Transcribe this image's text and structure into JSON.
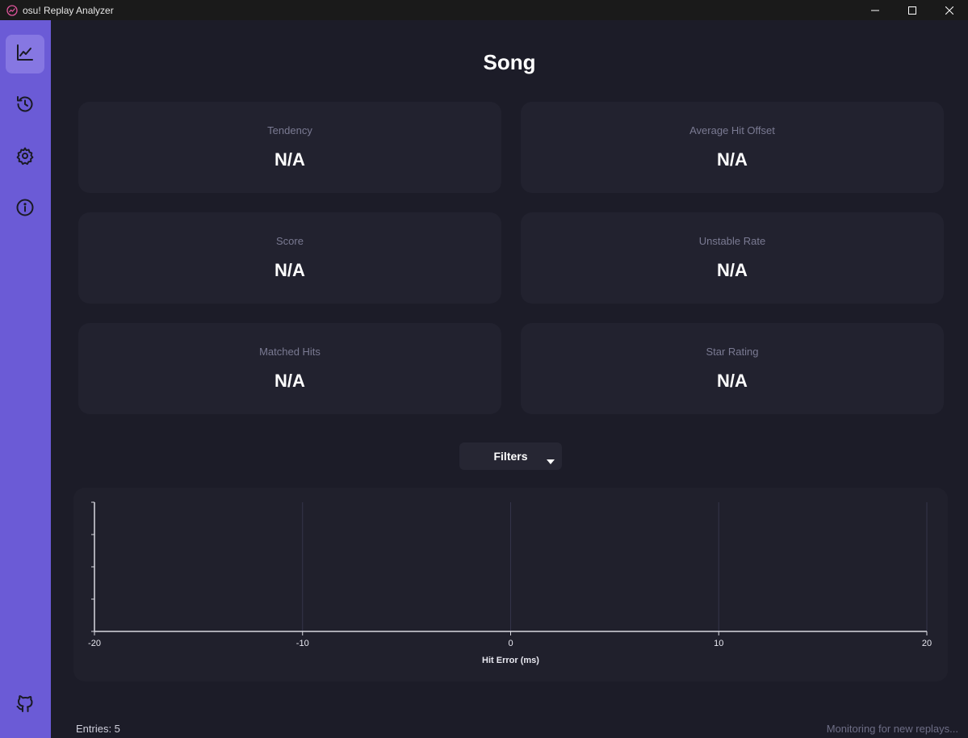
{
  "window": {
    "title": "osu! Replay Analyzer",
    "controls": [
      "minimize",
      "maximize",
      "close"
    ]
  },
  "sidebar": {
    "items": [
      {
        "name": "chart-icon",
        "active": true
      },
      {
        "name": "history-icon",
        "active": false
      },
      {
        "name": "settings-icon",
        "active": false
      },
      {
        "name": "info-icon",
        "active": false
      }
    ],
    "footer_icon": "github-icon"
  },
  "main": {
    "title": "Song",
    "stats": [
      {
        "label": "Tendency",
        "value": "N/A"
      },
      {
        "label": "Average Hit Offset",
        "value": "N/A"
      },
      {
        "label": "Score",
        "value": "N/A"
      },
      {
        "label": "Unstable Rate",
        "value": "N/A"
      },
      {
        "label": "Matched Hits",
        "value": "N/A"
      },
      {
        "label": "Star Rating",
        "value": "N/A"
      }
    ],
    "filters_label": "Filters"
  },
  "chart_data": {
    "type": "bar",
    "xlabel": "Hit Error (ms)",
    "xlim": [
      -20,
      20
    ],
    "xticks": [
      "-20",
      "-10",
      "0",
      "10",
      "20"
    ],
    "grid": "vertical",
    "series": []
  },
  "status": {
    "entries": "Entries: 5",
    "monitoring": "Monitoring for new replays..."
  },
  "colors": {
    "sidebar": "#6b5bd6",
    "sidebar_active": "#8677e2",
    "background": "#1c1c28",
    "card": "#22222f",
    "muted_text": "#7a7a92"
  }
}
